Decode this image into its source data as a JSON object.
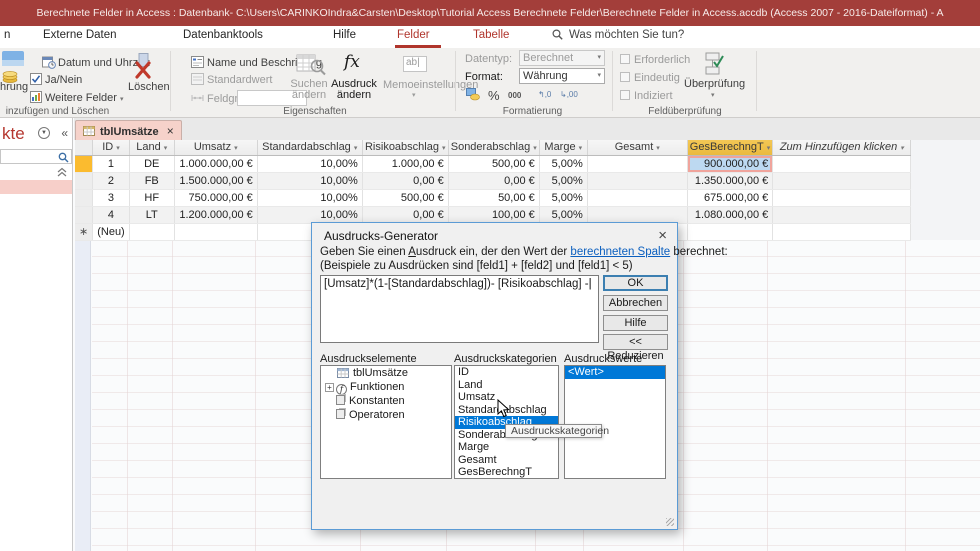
{
  "title_bar": {
    "text": "Berechnete Felder in Access : Datenbank- C:\\Users\\CARINKOIndra&Carsten\\Desktop\\Tutorial Access Berechnete Felder\\Berechnete Felder in Access.accdb (Access 2007 - 2016-Dateiformat)  -  A"
  },
  "ribbon": {
    "tabs": {
      "partial": "n",
      "externe_daten": "Externe Daten",
      "datenbanktools": "Datenbanktools",
      "hilfe": "Hilfe",
      "felder": "Felder",
      "tabelle": "Tabelle"
    },
    "search_label": "Was möchten Sie tun?",
    "groups": {
      "add_delete": {
        "label": "inzufügen und Löschen",
        "currency_partial": "hrung",
        "date_time": "Datum und Uhrzeit",
        "yes_no": "Ja/Nein",
        "more_fields": "Weitere Felder",
        "delete": "Löschen"
      },
      "properties": {
        "label": "Eigenschaften",
        "name_caption": "Name und Beschriftung",
        "default_value": "Standardwert",
        "field_size": "Feldgröße",
        "modify_lookup_1": "Suchen",
        "modify_lookup_2": "ändern",
        "modify_expression_1": "Ausdruck",
        "modify_expression_2": "ändern",
        "memo_settings": "Memoeinstellungen"
      },
      "formatting": {
        "label": "Formatierung",
        "datatype_label": "Datentyp:",
        "datatype_value": "Berechnet",
        "format_label": "Format:",
        "format_value": "Währung",
        "percent": "%",
        "thousands": "000",
        "dec_add": ",0",
        "dec_remove": ",00"
      },
      "field_validation": {
        "label": "Feldüberprüfung",
        "required": "Erforderlich",
        "unique": "Eindeutig",
        "indexed": "Indiziert",
        "validation": "Überprüfung"
      }
    }
  },
  "nav_pane": {
    "title_partial": "kte"
  },
  "document_tab": {
    "label": "tblUmsätze"
  },
  "table": {
    "columns": [
      "ID",
      "Land",
      "Umsatz",
      "Standardabschlag",
      "Risikoabschlag",
      "Sonderabschlag",
      "Marge",
      "Gesamt",
      "GesBerechngT",
      "Zum Hinzufügen klicken"
    ],
    "rows": [
      [
        "1",
        "DE",
        "1.000.000,00 €",
        "10,00%",
        "1.000,00 €",
        "500,00 €",
        "5,00%",
        "",
        "900.000,00 €",
        ""
      ],
      [
        "2",
        "FB",
        "1.500.000,00 €",
        "10,00%",
        "0,00 €",
        "0,00 €",
        "5,00%",
        "",
        "1.350.000,00 €",
        ""
      ],
      [
        "3",
        "HF",
        "750.000,00 €",
        "10,00%",
        "500,00 €",
        "50,00 €",
        "5,00%",
        "",
        "675.000,00 €",
        ""
      ],
      [
        "4",
        "LT",
        "1.200.000,00 €",
        "10,00%",
        "0,00 €",
        "100,00 €",
        "5,00%",
        "",
        "1.080.000,00 €",
        ""
      ]
    ],
    "new_row_label": "(Neu)",
    "new_row_marker": "∗"
  },
  "dialog": {
    "title": "Ausdrucks-Generator",
    "line1_pre": "Geben Sie einen ",
    "line1_accel": "A",
    "line1_accel_rest": "usdruck",
    "line1_mid": " ein, der den Wert der ",
    "line1_link": "berechneten Spalte",
    "line1_post": " berechnet:",
    "line2": "(Beispiele zu Ausdrücken sind [feld1] + [feld2] und [feld1] < 5)",
    "expression": "[Umsatz]*(1-[Standardabschlag])- [Risikoabschlag] -",
    "buttons": {
      "ok": "OK",
      "cancel": "Abbrechen",
      "help": "Hilfe",
      "reduce": "<< Reduzieren"
    },
    "elements_label": "Ausdruckselemente",
    "categories_label": "Ausdruckskategorien",
    "values_label": "Ausdruckswerte",
    "elements": [
      "tblUmsätze",
      "Funktionen",
      "Konstanten",
      "Operatoren"
    ],
    "categories": [
      "ID",
      "Land",
      "Umsatz",
      "Standardabschlag",
      "Risikoabschlag",
      "Sonderabschlag",
      "Marge",
      "Gesamt",
      "GesBerechngT"
    ],
    "values": [
      "<Wert>"
    ],
    "tooltip": "Ausdruckskategorien"
  },
  "colors": {
    "titlebar_red": "#A33E3A",
    "active_tab_red": "#B0352C",
    "nav_title_red": "#B5372F",
    "doc_tab_pink": "#F6D2CA",
    "selected_header_gold": "#EFBE48",
    "selected_cell_blue": "#BDD9F1",
    "selected_cell_border_pink": "#F0A49C",
    "row_marker_gold": "#FBBB2F",
    "list_selection_blue": "#0078D7",
    "link_blue": "#0B5FBF"
  }
}
